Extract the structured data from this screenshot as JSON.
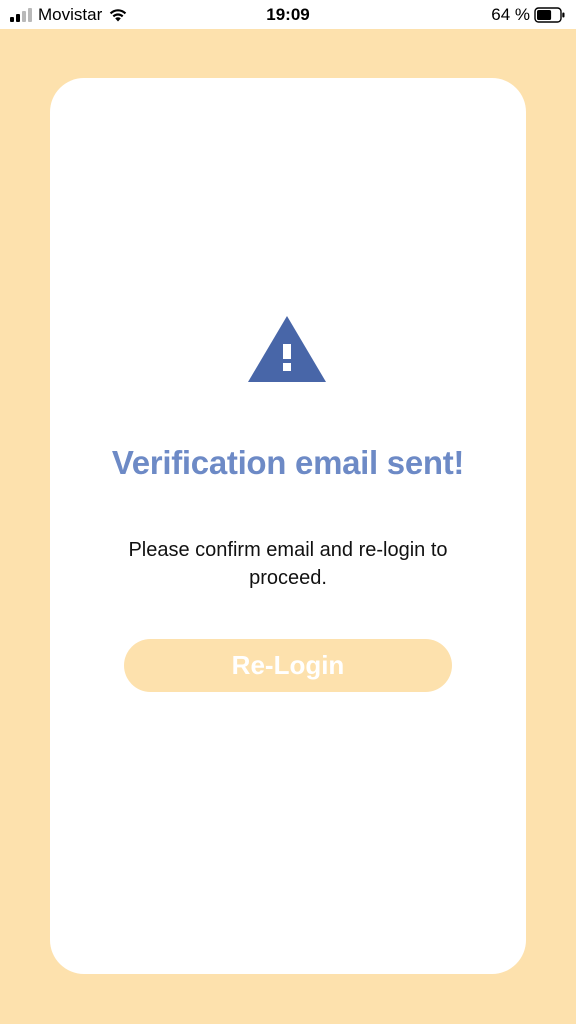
{
  "status_bar": {
    "carrier": "Movistar",
    "time": "19:09",
    "battery_percent": "64 %",
    "battery_level": 0.64,
    "signal_bars": 2,
    "icons": [
      "signal-icon",
      "wifi-icon",
      "battery-icon"
    ]
  },
  "dialog": {
    "icon": "warning-icon",
    "title": "Verification email sent!",
    "message": "Please confirm email and re-login to proceed.",
    "button_label": "Re-Login"
  },
  "colors": {
    "background": "#fde1ad",
    "card": "#ffffff",
    "title": "#6d8ac6",
    "icon": "#4866a8",
    "button": "#fde1ad",
    "button_text": "#ffffff"
  }
}
